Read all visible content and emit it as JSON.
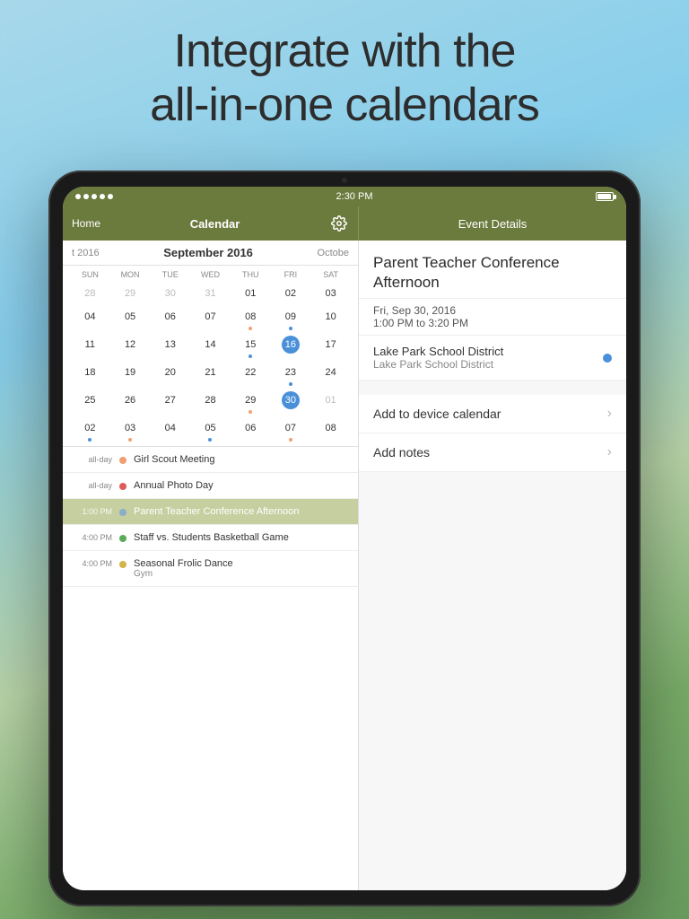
{
  "headline": {
    "line1": "Integrate with the",
    "line2": "all-in-one calendars"
  },
  "status_bar": {
    "dots": 5,
    "time": "2:30 PM",
    "battery_label": "Battery"
  },
  "nav": {
    "home_label": "Home",
    "calendar_label": "Calendar",
    "event_details_label": "Event Details"
  },
  "calendar": {
    "prev_month": "t 2016",
    "current_month": "September 2016",
    "next_month": "Octobe",
    "days_header": [
      "SUN",
      "MON",
      "TUE",
      "WED",
      "THU",
      "FRI",
      "SAT"
    ],
    "weeks": [
      [
        {
          "num": "28",
          "other": true,
          "dots": []
        },
        {
          "num": "29",
          "other": true,
          "dots": []
        },
        {
          "num": "30",
          "other": true,
          "dots": []
        },
        {
          "num": "31",
          "other": true,
          "dots": []
        },
        {
          "num": "01",
          "other": false,
          "dots": []
        },
        {
          "num": "02",
          "other": false,
          "dots": []
        },
        {
          "num": "03",
          "other": false,
          "dots": []
        }
      ],
      [
        {
          "num": "04",
          "other": false,
          "dots": []
        },
        {
          "num": "05",
          "other": false,
          "dots": []
        },
        {
          "num": "06",
          "other": false,
          "dots": []
        },
        {
          "num": "07",
          "other": false,
          "dots": []
        },
        {
          "num": "08",
          "other": false,
          "dots": [
            "orange"
          ]
        },
        {
          "num": "09",
          "other": false,
          "dots": [
            "blue"
          ]
        },
        {
          "num": "10",
          "other": false,
          "dots": []
        }
      ],
      [
        {
          "num": "11",
          "other": false,
          "dots": []
        },
        {
          "num": "12",
          "other": false,
          "dots": []
        },
        {
          "num": "13",
          "other": false,
          "dots": []
        },
        {
          "num": "14",
          "other": false,
          "dots": []
        },
        {
          "num": "15",
          "other": false,
          "dots": [
            "blue"
          ]
        },
        {
          "num": "16",
          "today": true,
          "other": false,
          "dots": []
        },
        {
          "num": "17",
          "other": false,
          "dots": []
        }
      ],
      [
        {
          "num": "18",
          "other": false,
          "dots": []
        },
        {
          "num": "19",
          "other": false,
          "dots": []
        },
        {
          "num": "20",
          "other": false,
          "dots": []
        },
        {
          "num": "21",
          "other": false,
          "dots": []
        },
        {
          "num": "22",
          "other": false,
          "dots": []
        },
        {
          "num": "23",
          "other": false,
          "dots": [
            "blue"
          ]
        },
        {
          "num": "24",
          "other": false,
          "dots": []
        }
      ],
      [
        {
          "num": "25",
          "other": false,
          "dots": []
        },
        {
          "num": "26",
          "other": false,
          "dots": []
        },
        {
          "num": "27",
          "other": false,
          "dots": []
        },
        {
          "num": "28",
          "other": false,
          "dots": []
        },
        {
          "num": "29",
          "other": false,
          "dots": [
            "orange"
          ]
        },
        {
          "num": "30",
          "selected": true,
          "other": false,
          "dots": []
        },
        {
          "num": "01",
          "other": true,
          "dots": []
        }
      ],
      [
        {
          "num": "02",
          "other": false,
          "dots": [
            "blue"
          ]
        },
        {
          "num": "03",
          "other": false,
          "dots": [
            "orange"
          ]
        },
        {
          "num": "04",
          "other": false,
          "dots": []
        },
        {
          "num": "05",
          "other": false,
          "dots": [
            "blue"
          ]
        },
        {
          "num": "06",
          "other": false,
          "dots": []
        },
        {
          "num": "07",
          "other": false,
          "dots": [
            "orange"
          ]
        },
        {
          "num": "08",
          "other": false,
          "dots": []
        }
      ]
    ]
  },
  "events": [
    {
      "time": "all-day",
      "color": "#f0a070",
      "title": "Girl Scout Meeting",
      "subtitle": "",
      "selected": false
    },
    {
      "time": "all-day",
      "color": "#e05a5a",
      "title": "Annual Photo Day",
      "subtitle": "",
      "selected": false
    },
    {
      "time": "1:00 PM",
      "color": "#8aadca",
      "title": "Parent Teacher Conference Afternoon",
      "subtitle": "",
      "selected": true
    },
    {
      "time": "4:00 PM",
      "color": "#5aab5a",
      "title": "Staff vs. Students Basketball Game",
      "subtitle": "",
      "selected": false
    },
    {
      "time": "4:00 PM",
      "color": "#d4b44a",
      "title": "Seasonal Frolic Dance",
      "subtitle": "Gym",
      "selected": false
    }
  ],
  "event_detail": {
    "title": "Parent Teacher Conference Afternoon",
    "date_time": "Fri, Sep 30, 2016\n1:00 PM to 3:20 PM",
    "date_line1": "Fri, Sep 30, 2016",
    "date_line2": "1:00 PM to 3:20 PM",
    "location_name": "Lake Park School District",
    "location_sub": "Lake Park School District",
    "add_to_calendar_label": "Add to device calendar",
    "add_notes_label": "Add notes"
  }
}
